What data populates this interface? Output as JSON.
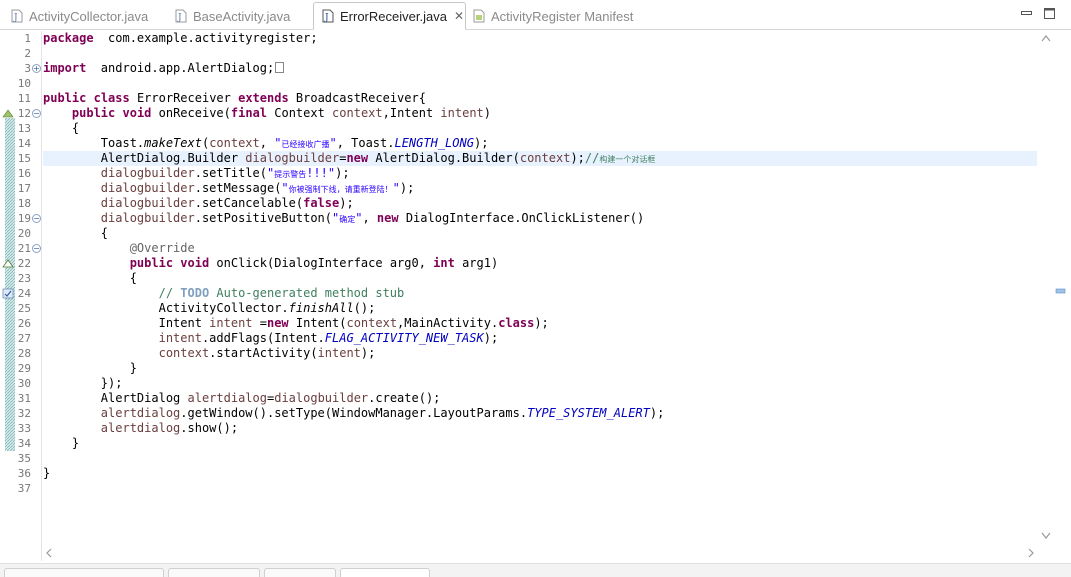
{
  "tabs": [
    {
      "label": "ActivityCollector.java",
      "icon": "java-file-icon",
      "active": false
    },
    {
      "label": "BaseActivity.java",
      "icon": "java-file-icon",
      "active": false
    },
    {
      "label": "ErrorReceiver.java",
      "icon": "java-file-icon",
      "active": true,
      "close": "✕"
    },
    {
      "label": "ActivityRegister Manifest",
      "icon": "android-manifest-icon",
      "active": false
    }
  ],
  "window_controls": [
    "minimize-icon",
    "maximize-icon"
  ],
  "editor": {
    "current_line": "15",
    "line_numbers": [
      "1",
      "2",
      "3",
      "10",
      "11",
      "12",
      "13",
      "14",
      "15",
      "16",
      "17",
      "18",
      "19",
      "20",
      "21",
      "22",
      "23",
      "24",
      "25",
      "26",
      "27",
      "28",
      "29",
      "30",
      "31",
      "32",
      "33",
      "34",
      "35",
      "36",
      "37"
    ],
    "fold_markers": {
      "3": "+",
      "12": "−",
      "19": "−",
      "21": "−"
    },
    "gutter_markers": {
      "12": "override-arrow-icon",
      "22": "implement-arrow-icon",
      "24": "task-marker-icon"
    },
    "lines": [
      [
        [
          "kw",
          "package"
        ],
        [
          "",
          "  com.example.activityregister;"
        ]
      ],
      [],
      [
        [
          "kw",
          "import"
        ],
        [
          "",
          "  android.app.AlertDialog;"
        ]
      ],
      [],
      [
        [
          "kw",
          "public"
        ],
        [
          "",
          " "
        ],
        [
          "kw",
          "class"
        ],
        [
          "",
          " ErrorReceiver "
        ],
        [
          "kw",
          "extends"
        ],
        [
          "",
          " BroadcastReceiver{"
        ]
      ],
      [
        [
          "",
          "    "
        ],
        [
          "kw",
          "public"
        ],
        [
          "",
          " "
        ],
        [
          "kw",
          "void"
        ],
        [
          "",
          " onReceive("
        ],
        [
          "kw",
          "final"
        ],
        [
          "",
          " Context "
        ],
        [
          "var",
          "context"
        ],
        [
          "",
          ",Intent "
        ],
        [
          "var",
          "intent"
        ],
        [
          "",
          ")"
        ]
      ],
      [
        [
          "",
          "    {"
        ]
      ],
      [
        [
          "",
          "        Toast."
        ],
        [
          "mth",
          "makeText"
        ],
        [
          "",
          "("
        ],
        [
          "var",
          "context"
        ],
        [
          "",
          ", "
        ],
        [
          "str",
          "\""
        ],
        [
          "str cjk",
          "已经接收广播"
        ],
        [
          "str",
          "\""
        ],
        [
          "",
          ", Toast."
        ],
        [
          "fld",
          "LENGTH_LONG"
        ],
        [
          "",
          ");"
        ]
      ],
      [
        [
          "",
          "        AlertDialog.Builder "
        ],
        [
          "var",
          "dialogbuilder"
        ],
        [
          "",
          "="
        ],
        [
          "kw",
          "new"
        ],
        [
          "",
          " AlertDialog.Builder("
        ],
        [
          "var",
          "context"
        ],
        [
          "",
          ");"
        ],
        [
          "cmt",
          "//"
        ],
        [
          "cmt cjk",
          "构建一个对话框"
        ]
      ],
      [
        [
          "",
          "        "
        ],
        [
          "var",
          "dialogbuilder"
        ],
        [
          "",
          ".setTitle("
        ],
        [
          "str",
          "\""
        ],
        [
          "str cjk",
          "提示警告"
        ],
        [
          "str",
          "!!!\""
        ],
        [
          "",
          ");"
        ]
      ],
      [
        [
          "",
          "        "
        ],
        [
          "var",
          "dialogbuilder"
        ],
        [
          "",
          ".setMessage("
        ],
        [
          "str",
          "\""
        ],
        [
          "str cjk",
          "你被强制下线，请重新登陆！"
        ],
        [
          "str",
          "\""
        ],
        [
          "",
          ");"
        ]
      ],
      [
        [
          "",
          "        "
        ],
        [
          "var",
          "dialogbuilder"
        ],
        [
          "",
          ".setCancelable("
        ],
        [
          "kw",
          "false"
        ],
        [
          "",
          ");"
        ]
      ],
      [
        [
          "",
          "        "
        ],
        [
          "var",
          "dialogbuilder"
        ],
        [
          "",
          ".setPositiveButton("
        ],
        [
          "str",
          "\""
        ],
        [
          "str cjk",
          "确定"
        ],
        [
          "str",
          "\""
        ],
        [
          "",
          ", "
        ],
        [
          "kw",
          "new"
        ],
        [
          "",
          " DialogInterface.OnClickListener()"
        ]
      ],
      [
        [
          "",
          "        {"
        ]
      ],
      [
        [
          "",
          "            "
        ],
        [
          "ann",
          "@Override"
        ]
      ],
      [
        [
          "",
          "            "
        ],
        [
          "kw",
          "public"
        ],
        [
          "",
          " "
        ],
        [
          "kw",
          "void"
        ],
        [
          "",
          " onClick(DialogInterface arg0, "
        ],
        [
          "kw",
          "int"
        ],
        [
          "",
          " arg1)"
        ]
      ],
      [
        [
          "",
          "            {"
        ]
      ],
      [
        [
          "",
          "                "
        ],
        [
          "cmt",
          "// "
        ],
        [
          "tag",
          "TODO"
        ],
        [
          "cmt",
          " Auto-generated method stub"
        ]
      ],
      [
        [
          "",
          "                ActivityCollector."
        ],
        [
          "mth",
          "finishAll"
        ],
        [
          "",
          "();"
        ]
      ],
      [
        [
          "",
          "                Intent "
        ],
        [
          "var",
          "intent"
        ],
        [
          "",
          " ="
        ],
        [
          "kw",
          "new"
        ],
        [
          "",
          " Intent("
        ],
        [
          "var",
          "context"
        ],
        [
          "",
          ",MainActivity."
        ],
        [
          "kw",
          "class"
        ],
        [
          "",
          ");"
        ]
      ],
      [
        [
          "",
          "                "
        ],
        [
          "var",
          "intent"
        ],
        [
          "",
          ".addFlags(Intent."
        ],
        [
          "fld",
          "FLAG_ACTIVITY_NEW_TASK"
        ],
        [
          "",
          ");"
        ]
      ],
      [
        [
          "",
          "                "
        ],
        [
          "var",
          "context"
        ],
        [
          "",
          ".startActivity("
        ],
        [
          "var",
          "intent"
        ],
        [
          "",
          ");"
        ]
      ],
      [
        [
          "",
          "            }"
        ]
      ],
      [
        [
          "",
          "        });"
        ]
      ],
      [
        [
          "",
          "        AlertDialog "
        ],
        [
          "var",
          "alertdialog"
        ],
        [
          "",
          "="
        ],
        [
          "var",
          "dialogbuilder"
        ],
        [
          "",
          ".create();"
        ]
      ],
      [
        [
          "",
          "        "
        ],
        [
          "var",
          "alertdialog"
        ],
        [
          "",
          ".getWindow().setType(WindowManager.LayoutParams."
        ],
        [
          "fld",
          "TYPE_SYSTEM_ALERT"
        ],
        [
          "",
          ");"
        ]
      ],
      [
        [
          "",
          "        "
        ],
        [
          "var",
          "alertdialog"
        ],
        [
          "",
          ".show();"
        ]
      ],
      [
        [
          "",
          "    }"
        ]
      ],
      [],
      [
        [
          "",
          "}"
        ]
      ],
      []
    ]
  },
  "scrollbars": {
    "vertical": "scroll-up-icon/scroll-down-icon",
    "horizontal": "scroll-left-icon/scroll-right-icon"
  }
}
